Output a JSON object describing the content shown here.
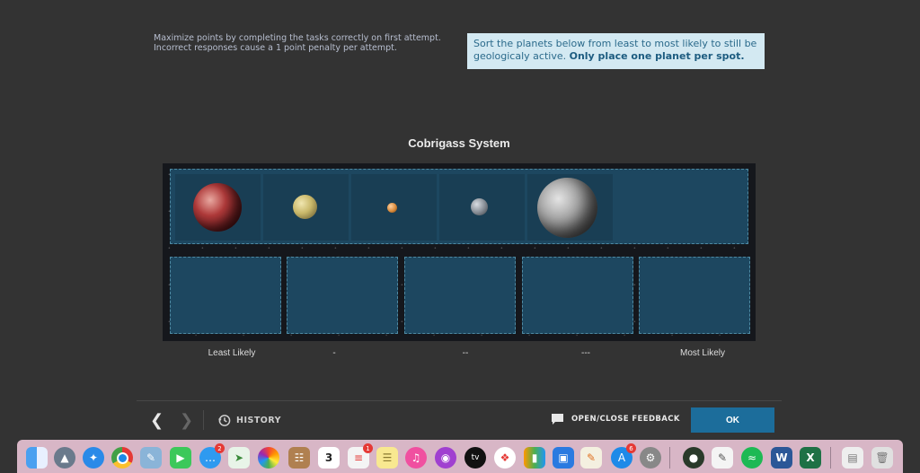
{
  "instructions": {
    "line1": "Maximize points by completing the tasks correctly on first attempt.",
    "line2": "Incorrect responses cause a 1 point penalty per attempt."
  },
  "prompt": {
    "text": "Sort the planets below from least to most likely to still be geologicaly active.",
    "emphasis": "Only place one planet per spot."
  },
  "system_title": "Cobrigass System",
  "planets": [
    {
      "name": "red-banded-planet",
      "color": "#b23a3a"
    },
    {
      "name": "yellow-planet",
      "color": "#c9b86a"
    },
    {
      "name": "orange-small-planet",
      "color": "#d88a3a"
    },
    {
      "name": "grey-small-planet",
      "color": "#8a9098"
    },
    {
      "name": "grey-large-planet",
      "color": "#9a9a9a"
    }
  ],
  "slot_labels": [
    "Least Likely",
    "-",
    "--",
    "---",
    "Most Likely"
  ],
  "footer": {
    "history_label": "HISTORY",
    "feedback_label": "OPEN/CLOSE FEEDBACK",
    "ok_label": "OK"
  },
  "dock": {
    "badges": {
      "messages": "2",
      "reminders": "1",
      "appstore": "6"
    },
    "calendar_day": "3",
    "tv_label": "tv"
  },
  "colors": {
    "accent": "#1c6d9b",
    "prompt_bg": "#d3e9f2",
    "slot_bg": "#1d4760"
  }
}
